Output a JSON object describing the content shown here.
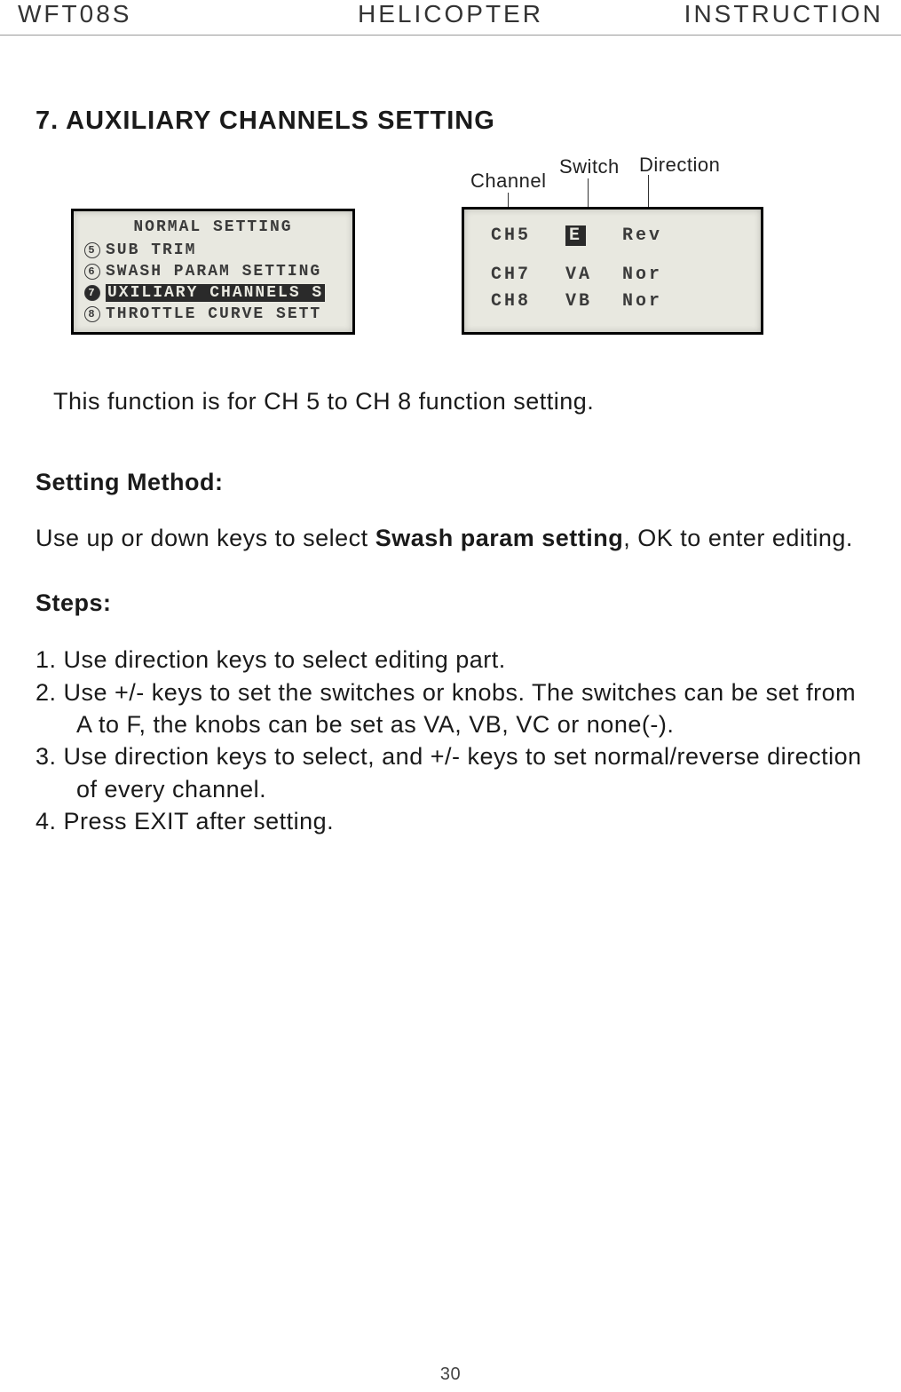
{
  "header": {
    "left": "WFT08S",
    "center": "HELICOPTER",
    "right": "INSTRUCTION"
  },
  "section_title": "7. AUXILIARY CHANNELS SETTING",
  "lcd_left": {
    "title": "NORMAL SETTING",
    "items": [
      {
        "num": "5",
        "label": "SUB TRIM",
        "filled": false,
        "hl": false
      },
      {
        "num": "6",
        "label": "SWASH PARAM SETTING",
        "filled": false,
        "hl": false
      },
      {
        "num": "7",
        "label": "UXILIARY CHANNELS S",
        "filled": true,
        "hl": true
      },
      {
        "num": "8",
        "label": "THROTTLE CURVE SETT",
        "filled": false,
        "hl": false
      }
    ]
  },
  "lcd_right": {
    "labels": {
      "channel": "Channel",
      "switch": "Switch",
      "direction": "Direction"
    },
    "rows": [
      {
        "ch": "CH5",
        "sw": "E",
        "sw_hl": true,
        "dir": "Rev"
      },
      {
        "ch": "CH7",
        "sw": "VA",
        "sw_hl": false,
        "dir": "Nor"
      },
      {
        "ch": "CH8",
        "sw": "VB",
        "sw_hl": false,
        "dir": "Nor"
      }
    ]
  },
  "intro": "This function is for CH 5 to CH 8 function setting.",
  "method_title": "Setting Method:",
  "method_text_pre": "Use up or down keys to select ",
  "method_text_bold": "Swash param setting",
  "method_text_post": ", OK to enter editing.",
  "steps_title": "Steps:",
  "steps": [
    "1. Use direction keys to select editing part.",
    "2. Use +/- keys to set the switches or knobs. The switches can be set from A to F, the knobs can be set as VA, VB, VC or none(-).",
    "3. Use direction keys to select, and  +/-  keys to set normal/reverse direction of every channel.",
    "4. Press EXIT after setting."
  ],
  "page_number": "30"
}
